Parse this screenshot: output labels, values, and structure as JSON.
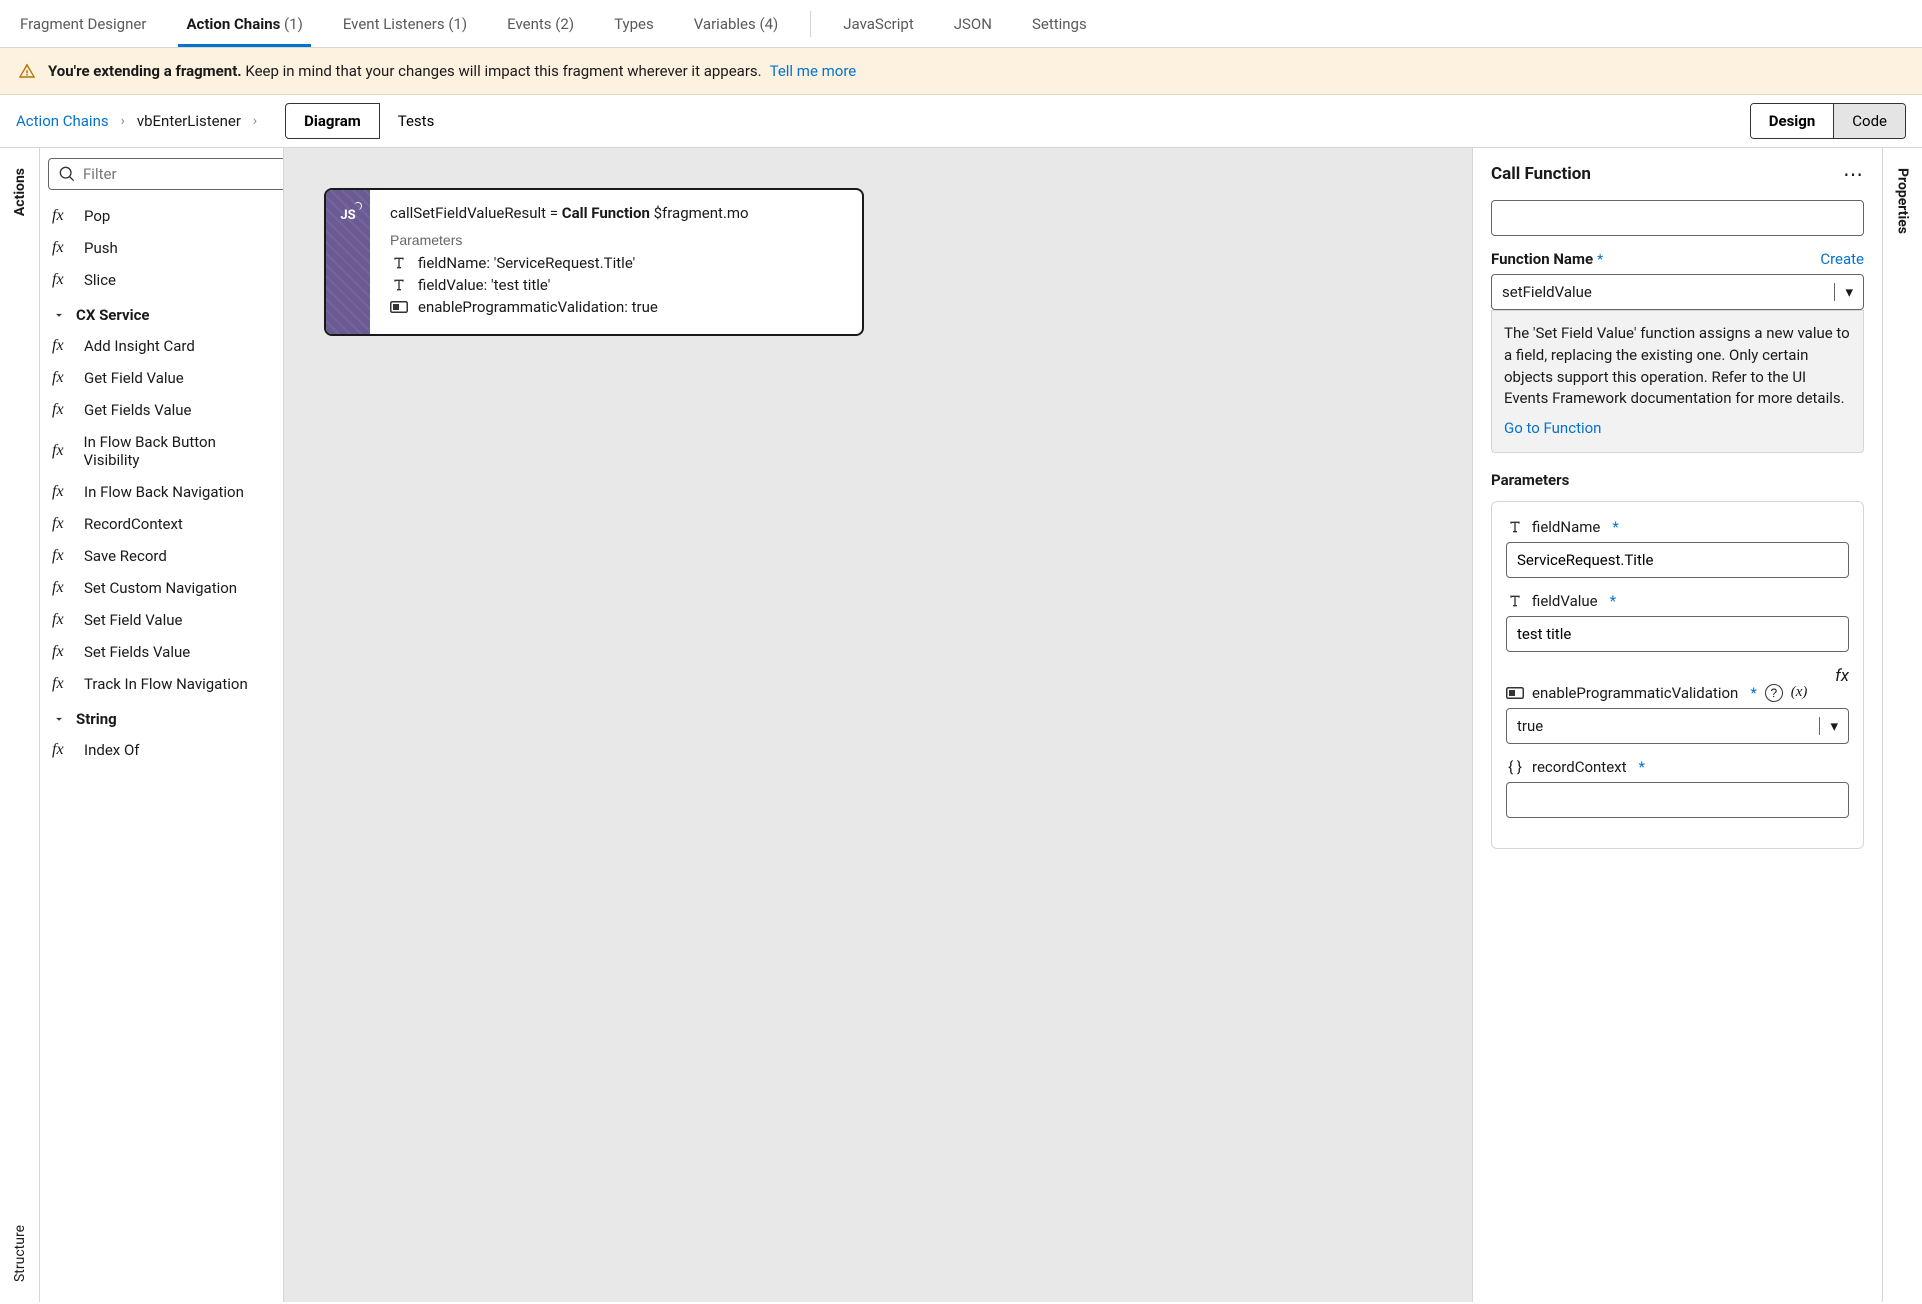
{
  "topnav": {
    "tabs": [
      {
        "label": "Fragment Designer",
        "count": ""
      },
      {
        "label": "Action Chains",
        "count": "(1)",
        "active": true
      },
      {
        "label": "Event Listeners",
        "count": "(1)"
      },
      {
        "label": "Events",
        "count": "(2)"
      },
      {
        "label": "Types",
        "count": ""
      },
      {
        "label": "Variables",
        "count": "(4)"
      },
      {
        "label": "JavaScript",
        "count": ""
      },
      {
        "label": "JSON",
        "count": ""
      },
      {
        "label": "Settings",
        "count": ""
      }
    ]
  },
  "banner": {
    "bold": "You're extending a fragment.",
    "text": "Keep in mind that your changes will impact this fragment wherever it appears.",
    "link": "Tell me more"
  },
  "breadcrumb": {
    "a": "Action Chains",
    "b": "vbEnterListener"
  },
  "seg": {
    "diagram": "Diagram",
    "tests": "Tests"
  },
  "view": {
    "design": "Design",
    "code": "Code"
  },
  "rails": {
    "actions": "Actions",
    "structure": "Structure",
    "properties": "Properties"
  },
  "palette": {
    "filter_placeholder": "Filter",
    "items1": [
      "Pop",
      "Push",
      "Slice"
    ],
    "group1": "CX Service",
    "items2": [
      "Add Insight Card",
      "Get Field Value",
      "Get Fields Value",
      "In Flow Back Button Visibility",
      "In Flow Back Navigation",
      "RecordContext",
      "Save Record",
      "Set Custom Navigation",
      "Set Field Value",
      "Set Fields Value",
      "Track In Flow Navigation"
    ],
    "group2": "String",
    "items3": [
      "Index Of"
    ]
  },
  "node": {
    "line_pre": "callSetFieldValueResult = ",
    "line_bold": "Call Function",
    "line_post": " $fragment.mo",
    "parameters_label": "Parameters",
    "p1": "fieldName: 'ServiceRequest.Title'",
    "p2": "fieldValue: 'test title'",
    "p3": "enableProgrammaticValidation: true"
  },
  "props": {
    "title": "Call Function",
    "fn_label": "Function Name",
    "create": "Create",
    "fn_value": "setFieldValue",
    "desc": "The 'Set Field Value' function assigns a new value to a field, replacing the existing one. Only certain objects support this operation. Refer to the UI Events Framework documentation for more details.",
    "goto": "Go to Function",
    "params_label": "Parameters",
    "p_fieldName": "fieldName",
    "p_fieldName_val": "ServiceRequest.Title",
    "p_fieldValue": "fieldValue",
    "p_fieldValue_val": "test title",
    "p_enable": "enableProgrammaticValidation",
    "p_enable_val": "true",
    "p_record": "recordContext"
  }
}
